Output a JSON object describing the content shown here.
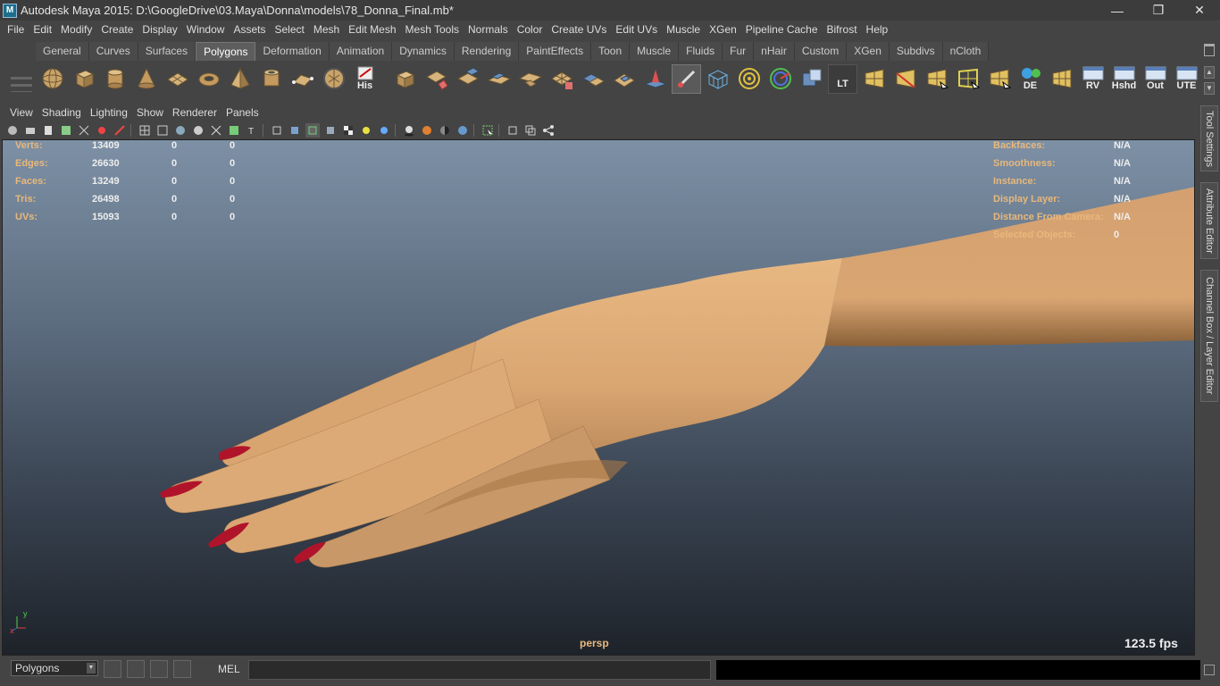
{
  "window": {
    "app_icon": "maya-logo-icon",
    "title": "Autodesk Maya 2015: D:\\GoogleDrive\\03.Maya\\Donna\\models\\78_Donna_Final.mb*",
    "controls": [
      "minimize",
      "restore",
      "close"
    ]
  },
  "menubar": [
    "File",
    "Edit",
    "Modify",
    "Create",
    "Display",
    "Window",
    "Assets",
    "Select",
    "Mesh",
    "Edit Mesh",
    "Mesh Tools",
    "Normals",
    "Color",
    "Create UVs",
    "Edit UVs",
    "Muscle",
    "XGen",
    "Pipeline Cache",
    "Bifrost",
    "Help"
  ],
  "shelf": {
    "tabs": [
      "General",
      "Curves",
      "Surfaces",
      "Polygons",
      "Deformation",
      "Animation",
      "Dynamics",
      "Rendering",
      "PaintEffects",
      "Toon",
      "Muscle",
      "Fluids",
      "Fur",
      "nHair",
      "Custom",
      "XGen",
      "Subdivs",
      "nCloth"
    ],
    "active_tab": "Polygons",
    "text_icons": {
      "history": "His",
      "lt": "LT",
      "de": "DE",
      "rv": "RV",
      "hshd": "Hshd",
      "out": "Out",
      "ute": "UTE"
    }
  },
  "panel": {
    "menus": [
      "View",
      "Shading",
      "Lighting",
      "Show",
      "Renderer",
      "Panels"
    ]
  },
  "hud_left": [
    {
      "label": "Verts:",
      "values": [
        "13409",
        "0",
        "0"
      ]
    },
    {
      "label": "Edges:",
      "values": [
        "26630",
        "0",
        "0"
      ]
    },
    {
      "label": "Faces:",
      "values": [
        "13249",
        "0",
        "0"
      ]
    },
    {
      "label": "Tris:",
      "values": [
        "26498",
        "0",
        "0"
      ]
    },
    {
      "label": "UVs:",
      "values": [
        "15093",
        "0",
        "0"
      ]
    }
  ],
  "hud_right": [
    {
      "label": "Backfaces:",
      "value": "N/A"
    },
    {
      "label": "Smoothness:",
      "value": "N/A"
    },
    {
      "label": "Instance:",
      "value": "N/A"
    },
    {
      "label": "Display Layer:",
      "value": "N/A"
    },
    {
      "label": "Distance From Camera:",
      "value": "N/A"
    },
    {
      "label": "Selected Objects:",
      "value": "0"
    }
  ],
  "viewport": {
    "camera": "persp",
    "fps": "123.5 fps",
    "axis_x": "x",
    "axis_y": "y",
    "skin_color": "#d9a672",
    "nail_color": "#b0142a"
  },
  "side_tabs": [
    "Tool Settings",
    "Attribute Editor",
    "Channel Box / Layer Editor"
  ],
  "command_line": {
    "mode": "Polygons",
    "language": "MEL"
  }
}
